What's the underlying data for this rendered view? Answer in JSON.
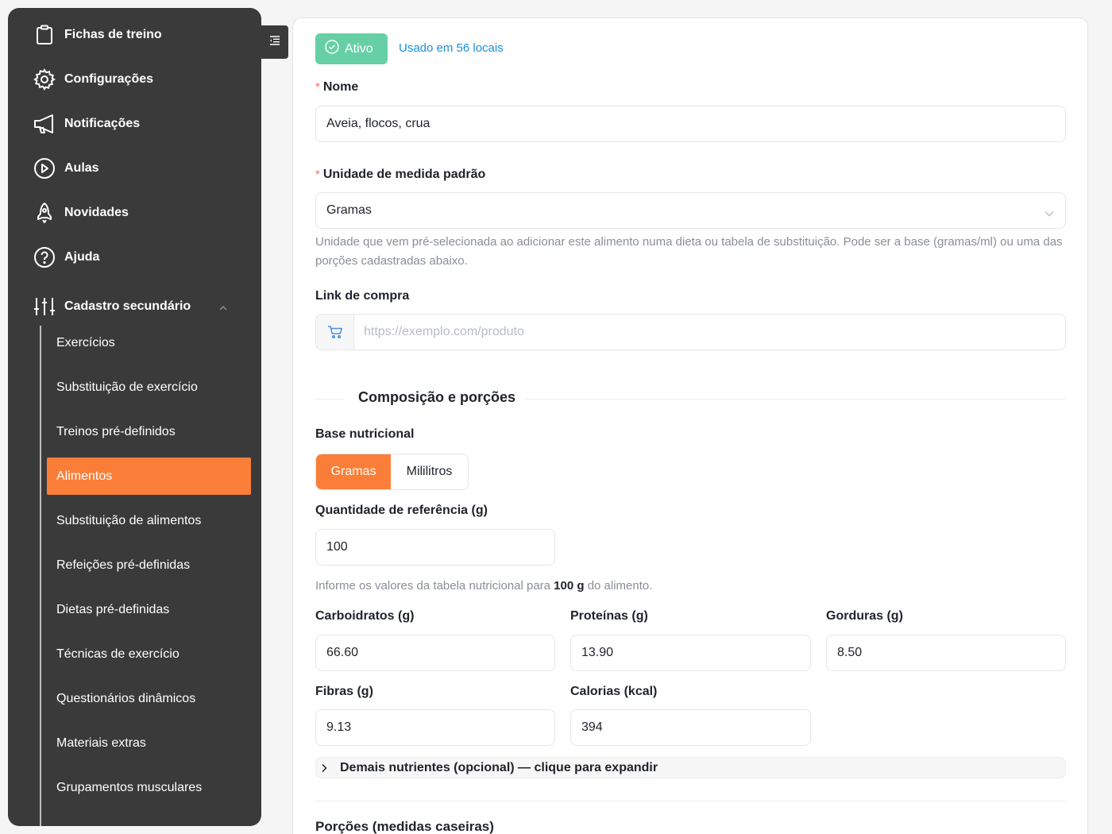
{
  "sidebar": {
    "items": [
      {
        "label": "Fichas de treino",
        "icon": "clipboard-icon"
      },
      {
        "label": "Configurações",
        "icon": "gear-icon"
      },
      {
        "label": "Notificações",
        "icon": "megaphone-icon"
      },
      {
        "label": "Aulas",
        "icon": "play-circle-icon"
      },
      {
        "label": "Novidades",
        "icon": "rocket-icon"
      },
      {
        "label": "Ajuda",
        "icon": "help-circle-icon"
      },
      {
        "label": "Cadastro secundário",
        "icon": "sliders-icon"
      }
    ],
    "subitems": [
      "Exercícios",
      "Substituição de exercício",
      "Treinos pré-definidos",
      "Alimentos",
      "Substituição de alimentos",
      "Refeições pré-definidas",
      "Dietas pré-definidas",
      "Técnicas de exercício",
      "Questionários dinâmicos",
      "Materiais extras",
      "Grupamentos musculares"
    ],
    "active_subitem": "Alimentos"
  },
  "form": {
    "status": "Ativo",
    "usage": "Usado em 56 locais",
    "name": {
      "label": "Nome",
      "value": "Aveia, flocos, crua"
    },
    "unit": {
      "label": "Unidade de medida padrão",
      "value": "Gramas",
      "help": "Unidade que vem pré-selecionada ao adicionar este alimento numa dieta ou tabela de substituição. Pode ser a base (gramas/ml) ou uma das porções cadastradas abaixo."
    },
    "link": {
      "label": "Link de compra",
      "placeholder": "https://exemplo.com/produto"
    },
    "section_title": "Composição e porções",
    "base": {
      "label": "Base nutricional",
      "options": [
        "Gramas",
        "Mililitros"
      ],
      "selected": "Gramas"
    },
    "reference": {
      "label": "Quantidade de referência (g)",
      "value": "100"
    },
    "info": {
      "prefix": "Informe os valores da tabela nutricional para ",
      "bold": "100 g",
      "suffix": " do alimento."
    },
    "nutrients": {
      "carbs": {
        "label": "Carboidratos (g)",
        "value": "66.60"
      },
      "protein": {
        "label": "Proteínas (g)",
        "value": "13.90"
      },
      "fat": {
        "label": "Gorduras (g)",
        "value": "8.50"
      },
      "fiber": {
        "label": "Fibras (g)",
        "value": "9.13"
      },
      "calories": {
        "label": "Calorias (kcal)",
        "value": "394"
      }
    },
    "more_nutrients": "Demais nutrientes (opcional) — clique para expandir",
    "portions_title": "Porções (medidas caseiras)"
  },
  "colors": {
    "accent": "#fa7e38",
    "active_status": "#66cfa6",
    "link": "#1d8fd6",
    "sidebar": "#3a3a3b"
  }
}
